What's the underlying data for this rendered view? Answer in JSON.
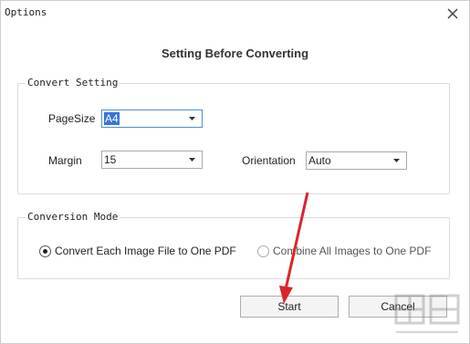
{
  "window": {
    "title": "Options"
  },
  "heading": "Setting Before Converting",
  "convert_setting": {
    "legend": "Convert Setting",
    "pagesize_label": "PageSize",
    "pagesize_value": "A4",
    "margin_label": "Margin",
    "margin_value": "15",
    "orientation_label": "Orientation",
    "orientation_value": "Auto"
  },
  "conversion_mode": {
    "legend": "Conversion Mode",
    "options": [
      {
        "label": "Convert Each Image File to One PDF",
        "selected": true
      },
      {
        "label": "Combine All Images to One PDF",
        "selected": false
      }
    ]
  },
  "buttons": {
    "start": "Start",
    "cancel": "Cancel"
  },
  "colors": {
    "annotation_arrow": "#d9262b",
    "selection": "#3875d7"
  }
}
